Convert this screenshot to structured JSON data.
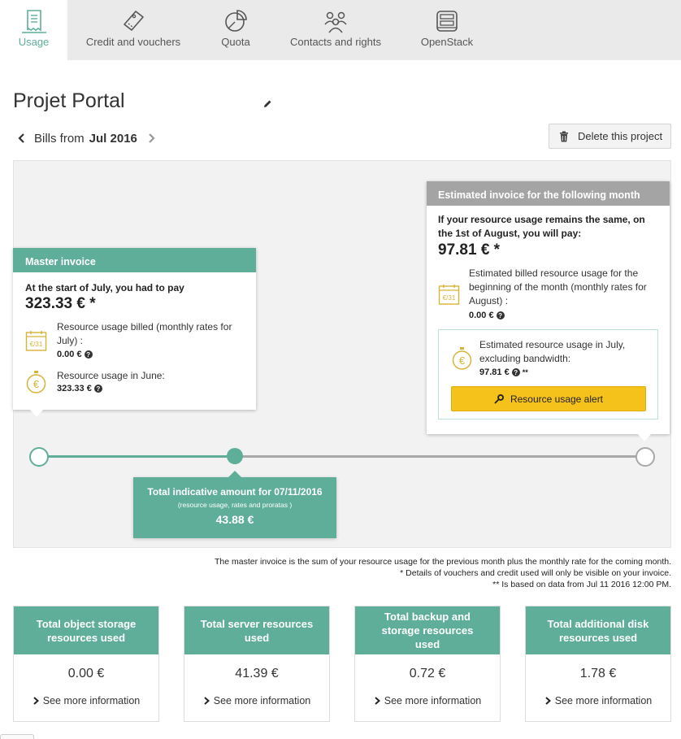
{
  "tabs": [
    {
      "label": "Usage",
      "icon": "receipt-icon",
      "active": true
    },
    {
      "label": "Credit and vouchers",
      "icon": "voucher-icon"
    },
    {
      "label": "Quota",
      "icon": "pie-chart-icon"
    },
    {
      "label": "Contacts and rights",
      "icon": "users-icon"
    },
    {
      "label": "OpenStack",
      "icon": "openstack-icon"
    }
  ],
  "project": {
    "title": "Projet Portal"
  },
  "bills": {
    "prefix": "Bills from",
    "month": "Jul 2016"
  },
  "delete_label": "Delete this project",
  "master": {
    "header": "Master invoice",
    "intro": "At the start of July, you had to pay",
    "amount": "323.33 € *",
    "billed_label": "Resource usage billed (monthly rates for July) :",
    "billed_value": "0.00 €",
    "usage_label": "Resource usage in June:",
    "usage_value": "323.33 €"
  },
  "estimate": {
    "header": "Estimated invoice for the following month",
    "intro": "If your resource usage remains the same, on the 1st of August, you will pay:",
    "amount": "97.81 € *",
    "billed_label": "Estimated billed resource usage for the beginning of the month (monthly rates for August) :",
    "billed_value": "0.00 €",
    "usage_label": "Estimated resource usage in July, excluding bandwidth:",
    "usage_value": "97.81 €",
    "usage_suffix": "**",
    "alert_label": "Resource usage alert"
  },
  "icons": {
    "calendar_text": "€/31",
    "coin_text": "€"
  },
  "timeline": {
    "title": "Total indicative amount for 07/11/2016",
    "subtitle": "(resource usage, rates and proratas )",
    "amount": "43.88 €"
  },
  "notes": [
    "The master invoice is the sum of your resource usage for the previous month plus the monthly rate for the coming month.",
    "* Details of vouchers and credit used will only be visible on your invoice.",
    "** Is based on data from Jul 11 2016 12:00 PM."
  ],
  "summaries": [
    {
      "title": "Total object storage resources used",
      "value": "0.00 €",
      "link": "See more information"
    },
    {
      "title": "Total server resources used",
      "value": "41.39 €",
      "link": "See more information"
    },
    {
      "title": "Total backup and storage resources used",
      "value": "0.72 €",
      "link": "See more information"
    },
    {
      "title": "Total additional disk resources used",
      "value": "1.78 €",
      "link": "See more information"
    }
  ],
  "colors": {
    "accent": "#5fae99",
    "grey_header": "#a4a4a4",
    "alert": "#f5c21b",
    "icon_gold": "#d7b336"
  }
}
